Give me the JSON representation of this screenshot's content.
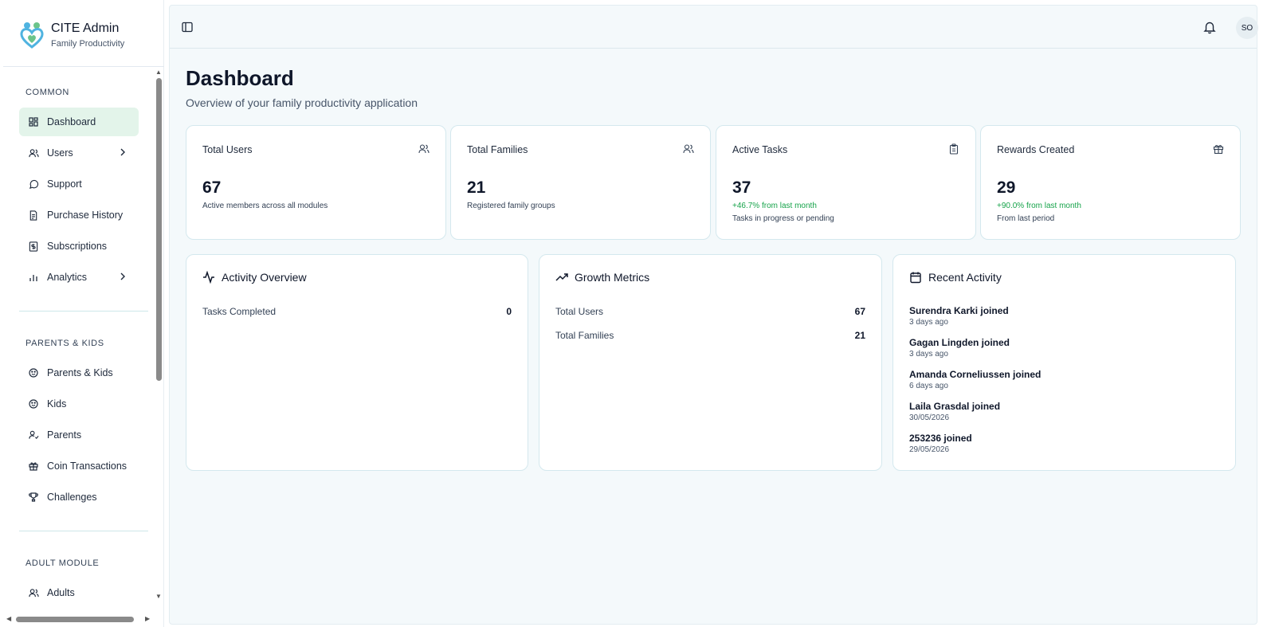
{
  "brand": {
    "title": "CITE Admin",
    "subtitle": "Family Productivity"
  },
  "sidebar": {
    "sections": [
      {
        "label": "COMMON"
      },
      {
        "label": "PARENTS & KIDS"
      },
      {
        "label": "ADULT MODULE"
      }
    ],
    "items": [
      {
        "label": "Dashboard",
        "icon": "dashboard-icon",
        "active": true
      },
      {
        "label": "Users",
        "icon": "users-icon",
        "has_submenu": true
      },
      {
        "label": "Support",
        "icon": "chat-icon"
      },
      {
        "label": "Purchase History",
        "icon": "receipt-icon"
      },
      {
        "label": "Subscriptions",
        "icon": "dollar-icon"
      },
      {
        "label": "Analytics",
        "icon": "bar-chart-icon",
        "has_submenu": true
      },
      {
        "label": "Parents & Kids",
        "icon": "smile-icon"
      },
      {
        "label": "Kids",
        "icon": "smile-icon"
      },
      {
        "label": "Parents",
        "icon": "user-check-icon"
      },
      {
        "label": "Coin Transactions",
        "icon": "gift-icon"
      },
      {
        "label": "Challenges",
        "icon": "trophy-icon"
      },
      {
        "label": "Adults",
        "icon": "user-icon"
      }
    ]
  },
  "header": {
    "avatar_initials": "SO"
  },
  "page": {
    "title": "Dashboard",
    "subtitle": "Overview of your family productivity application"
  },
  "stats": [
    {
      "title": "Total Users",
      "value": "67",
      "description": "Active members across all modules",
      "icon": "users-icon"
    },
    {
      "title": "Total Families",
      "value": "21",
      "description": "Registered family groups",
      "icon": "users-icon"
    },
    {
      "title": "Active Tasks",
      "value": "37",
      "trend": "+46.7% from last month",
      "description": "Tasks in progress or pending",
      "icon": "clipboard-icon"
    },
    {
      "title": "Rewards Created",
      "value": "29",
      "trend": "+90.0% from last month",
      "description": "From last period",
      "icon": "gift-icon"
    }
  ],
  "activity_overview": {
    "title": "Activity Overview",
    "rows": [
      {
        "label": "Tasks Completed",
        "value": "0"
      }
    ]
  },
  "growth_metrics": {
    "title": "Growth Metrics",
    "rows": [
      {
        "label": "Total Users",
        "value": "67"
      },
      {
        "label": "Total Families",
        "value": "21"
      }
    ]
  },
  "recent_activity": {
    "title": "Recent Activity",
    "items": [
      {
        "name": "Surendra Karki joined",
        "time": "3 days ago"
      },
      {
        "name": "Gagan Lingden joined",
        "time": "3 days ago"
      },
      {
        "name": "Amanda Corneliussen joined",
        "time": "6 days ago"
      },
      {
        "name": "Laila Grasdal joined",
        "time": "30/05/2026"
      },
      {
        "name": "253236 joined",
        "time": "29/05/2026"
      }
    ]
  },
  "colors": {
    "accent_green": "#16a34a",
    "active_nav_bg": "#e3f4ea",
    "main_bg": "#f4f9fb"
  }
}
